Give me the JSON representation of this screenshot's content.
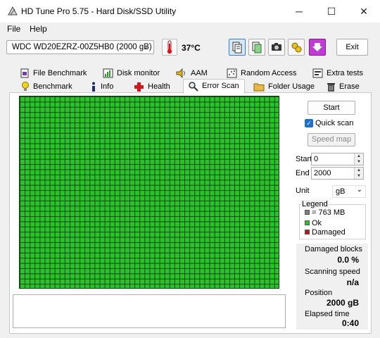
{
  "window": {
    "title": "HD Tune Pro 5.75 - Hard Disk/SSD Utility",
    "minimize": "─",
    "maximize": "☐",
    "close": "✕"
  },
  "menu": {
    "file": "File",
    "help": "Help"
  },
  "toolbar": {
    "drive": "WDC WD20EZRZ-00Z5HB0 (2000 gB)",
    "temperature": "37°C",
    "exit_label": "Exit",
    "buttons": [
      "copy-info-icon",
      "copy-text-icon",
      "screenshot-icon",
      "options-icon",
      "download-icon"
    ]
  },
  "tabs_row1": [
    {
      "label": "File Benchmark",
      "icon": "file-benchmark-icon"
    },
    {
      "label": "Disk monitor",
      "icon": "disk-monitor-icon"
    },
    {
      "label": "AAM",
      "icon": "speaker-icon"
    },
    {
      "label": "Random Access",
      "icon": "random-access-icon"
    },
    {
      "label": "Extra tests",
      "icon": "extra-tests-icon"
    }
  ],
  "tabs_row2": [
    {
      "label": "Benchmark",
      "icon": "lightbulb-icon"
    },
    {
      "label": "Info",
      "icon": "info-icon"
    },
    {
      "label": "Health",
      "icon": "health-cross-icon"
    },
    {
      "label": "Error Scan",
      "icon": "magnifier-icon",
      "active": true
    },
    {
      "label": "Folder Usage",
      "icon": "folder-icon"
    },
    {
      "label": "Erase",
      "icon": "trash-icon"
    }
  ],
  "scan": {
    "start_label": "Start",
    "quick_scan_label": "Quick scan",
    "quick_scan_checked": true,
    "speed_map_label": "Speed map",
    "start_field_label": "Start",
    "start_value": "0",
    "end_field_label": "End",
    "end_value": "2000",
    "unit_label": "Unit",
    "unit_value": "gB",
    "block_state": "all ok"
  },
  "legend": {
    "title": "Legend",
    "items": [
      {
        "label": "= 763 MB",
        "color": "#808080"
      },
      {
        "label": "Ok",
        "color": "#2ebf2e"
      },
      {
        "label": "Damaged",
        "color": "#c0161b"
      }
    ]
  },
  "stats": {
    "damaged_blocks_label": "Damaged blocks",
    "damaged_blocks_value": "0.0 %",
    "scanning_speed_label": "Scanning speed",
    "scanning_speed_value": "n/a",
    "position_label": "Position",
    "position_value": "2000 gB",
    "elapsed_label": "Elapsed time",
    "elapsed_value": "0:40"
  },
  "colors": {
    "ok": "#2ebf2e",
    "grid_line": "#0a4a0a",
    "accent": "#1f6fd1"
  }
}
